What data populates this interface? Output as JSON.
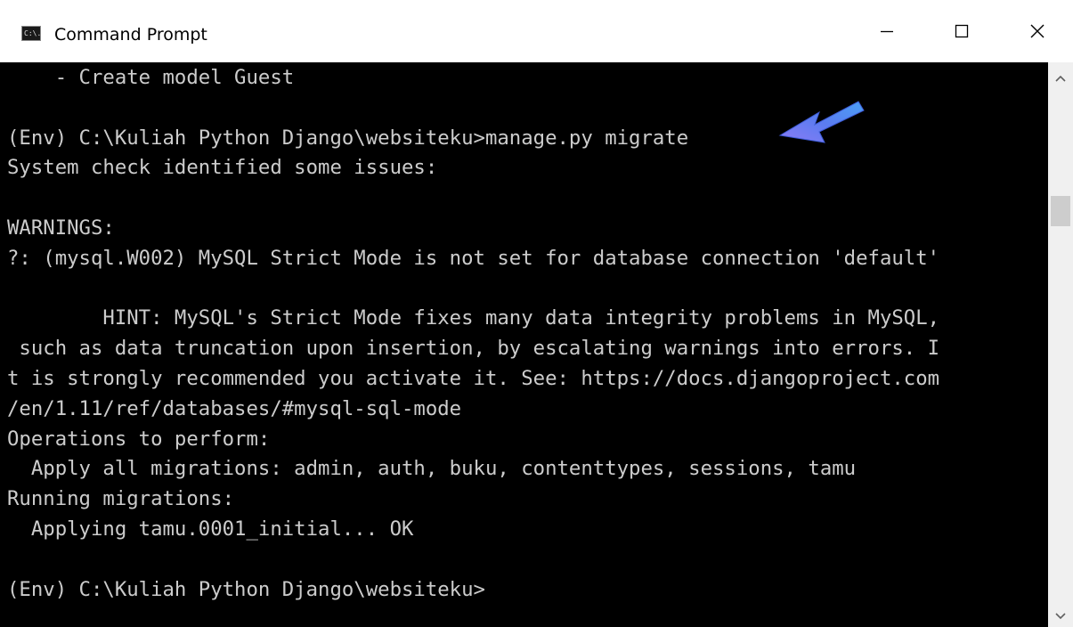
{
  "window": {
    "title": "Command Prompt",
    "icon_text": "C:\\."
  },
  "title_buttons": {
    "minimize": "minimize-icon",
    "maximize": "maximize-icon",
    "close": "close-icon"
  },
  "console": {
    "lines": [
      "    - Create model Guest",
      "",
      "(Env) C:\\Kuliah Python Django\\websiteku>manage.py migrate",
      "System check identified some issues:",
      "",
      "WARNINGS:",
      "?: (mysql.W002) MySQL Strict Mode is not set for database connection 'default'",
      "",
      "        HINT: MySQL's Strict Mode fixes many data integrity problems in MySQL,",
      " such as data truncation upon insertion, by escalating warnings into errors. I",
      "t is strongly recommended you activate it. See: https://docs.djangoproject.com",
      "/en/1.11/ref/databases/#mysql-sql-mode",
      "Operations to perform:",
      "  Apply all migrations: admin, auth, buku, contenttypes, sessions, tamu",
      "Running migrations:",
      "  Applying tamu.0001_initial... OK",
      "",
      "(Env) C:\\Kuliah Python Django\\websiteku>"
    ]
  },
  "colors": {
    "console_bg": "#000000",
    "console_text": "#cccccc",
    "titlebar_bg": "#ffffff",
    "scrollbar_bg": "#f0f0f0",
    "pointer_arrow": "#5b7cf0"
  }
}
